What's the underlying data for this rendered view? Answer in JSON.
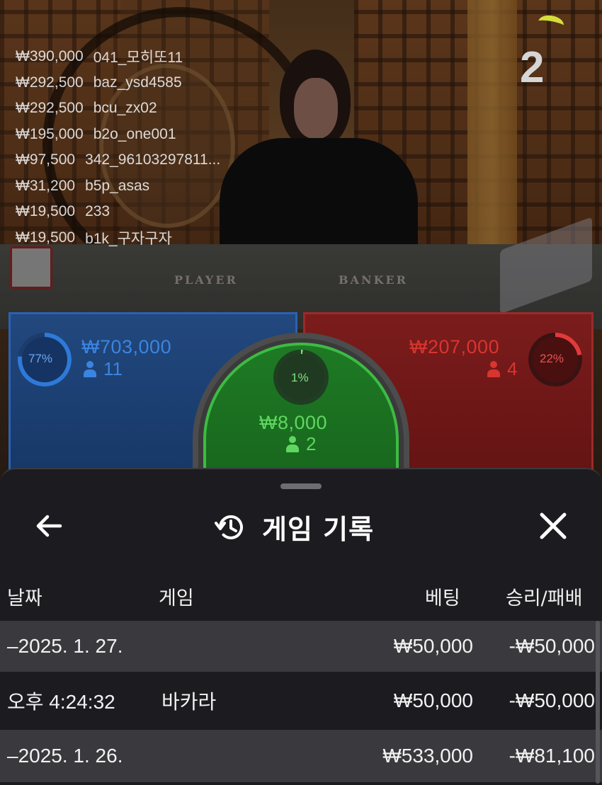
{
  "round_number": "2",
  "table_labels": {
    "player": "PLAYER",
    "banker": "BANKER"
  },
  "top_bets": [
    {
      "amount": "₩390,000",
      "user": "041_모히또11"
    },
    {
      "amount": "₩292,500",
      "user": "baz_ysd4585"
    },
    {
      "amount": "₩292,500",
      "user": "bcu_zx02"
    },
    {
      "amount": "₩195,000",
      "user": "b2o_one001"
    },
    {
      "amount": "₩97,500",
      "user": "342_96103297811..."
    },
    {
      "amount": "₩31,200",
      "user": "b5p_asas"
    },
    {
      "amount": "₩19,500",
      "user": "233"
    },
    {
      "amount": "₩19,500",
      "user": "b1k_구자구자"
    }
  ],
  "betting_spots": {
    "player": {
      "percent": "77%",
      "percent_value": 77,
      "amount": "₩703,000",
      "players": "11",
      "color": "#2d7ad8"
    },
    "tie": {
      "percent": "1%",
      "percent_value": 1,
      "amount": "₩8,000",
      "players": "2",
      "color": "#7ee07e"
    },
    "banker": {
      "percent": "22%",
      "percent_value": 22,
      "amount": "₩207,000",
      "players": "4",
      "color": "#e23a3a"
    }
  },
  "history_sheet": {
    "title": "게임 기록",
    "icons": {
      "back": "arrow-left-icon",
      "history": "history-icon",
      "close": "close-icon"
    },
    "columns": {
      "date": "날짜",
      "game": "게임",
      "bet": "베팅",
      "win_loss": "승리/패배"
    },
    "rows": [
      {
        "type": "date",
        "date": "–2025. 1. 27.",
        "game": "",
        "bet": "₩50,000",
        "win_loss": "-₩50,000"
      },
      {
        "type": "game",
        "date": "오후 4:24:32",
        "game": "바카라",
        "bet": "₩50,000",
        "win_loss": "-₩50,000"
      },
      {
        "type": "date",
        "date": "–2025. 1. 26.",
        "game": "",
        "bet": "₩533,000",
        "win_loss": "-₩81,100"
      }
    ]
  }
}
